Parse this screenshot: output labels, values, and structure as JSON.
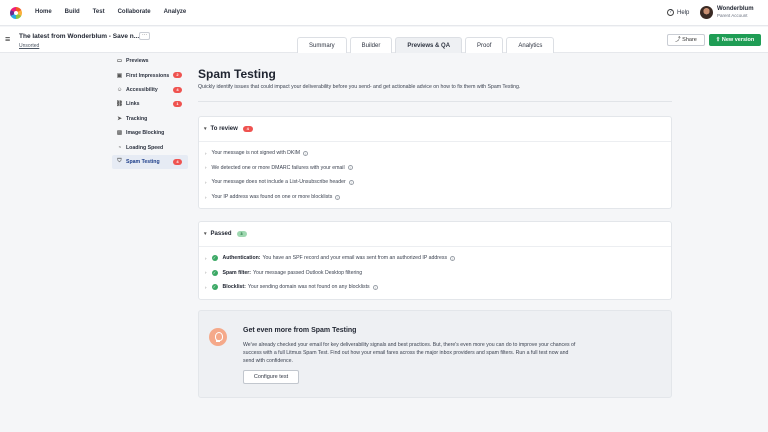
{
  "nav": {
    "items": [
      "Home",
      "Build",
      "Test",
      "Collaborate",
      "Analyze"
    ]
  },
  "help": {
    "label": "Help"
  },
  "account": {
    "name": "Wonderblum",
    "role": "Parent Account"
  },
  "campaign": {
    "title": "The latest from Wonderblum - Save n...",
    "more": "···",
    "folder": "Unsorted"
  },
  "tabs": [
    "Summary",
    "Builder",
    "Previews & QA",
    "Proof",
    "Analytics"
  ],
  "actions": {
    "share": "Share",
    "new_version": "New version"
  },
  "sidebar": {
    "items": [
      {
        "label": "Previews",
        "icon": "monitor-icon",
        "badge": ""
      },
      {
        "label": "First Impressions",
        "icon": "inbox-icon",
        "badge": "2"
      },
      {
        "label": "Accessibility",
        "icon": "accessibility-icon",
        "badge": "4"
      },
      {
        "label": "Links",
        "icon": "link-icon",
        "badge": "1"
      },
      {
        "label": "Tracking",
        "icon": "send-icon",
        "badge": ""
      },
      {
        "label": "Image Blocking",
        "icon": "image-icon",
        "badge": ""
      },
      {
        "label": "Loading Speed",
        "icon": "speed-icon",
        "badge": ""
      },
      {
        "label": "Spam Testing",
        "icon": "shield-icon",
        "badge": "4"
      }
    ]
  },
  "main": {
    "title": "Spam Testing",
    "subtitle": "Quickly identify issues that could impact your deliverability before you send- and get actionable advice on how to fix them with Spam Testing.",
    "review": {
      "title": "To review",
      "count": "4",
      "items": [
        "Your message is not signed with DKIM",
        "We detected one or more DMARC failures with your email",
        "Your message does not include a List-Unsubscribe header",
        "Your IP address was found on one or more blocklists"
      ]
    },
    "passed": {
      "title": "Passed",
      "count": "3",
      "items": [
        {
          "label": "Authentication:",
          "text": "You have an SPF record and your email was sent from an authorized IP address"
        },
        {
          "label": "Spam filter:",
          "text": "Your message passed Outlook Desktop filtering"
        },
        {
          "label": "Blocklist:",
          "text": "Your sending domain was not found on any blocklists"
        }
      ]
    },
    "promo": {
      "title": "Get even more from Spam Testing",
      "body": "We've already checked your email for key deliverability signals and best practices. But, there's even more you can do to improve your chances of success with a full Litmus Spam Test. Find out how your email fares across the major inbox providers and spam filters. Run a full test now and send with confidence.",
      "button": "Configure test"
    }
  }
}
